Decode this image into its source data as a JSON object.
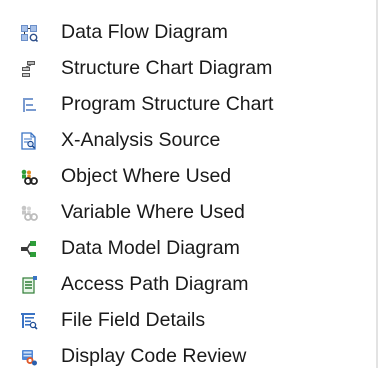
{
  "menu": {
    "items": [
      {
        "label": "Data Flow Diagram",
        "icon": "data-flow-diagram-icon"
      },
      {
        "label": "Structure Chart Diagram",
        "icon": "structure-chart-icon"
      },
      {
        "label": "Program Structure Chart",
        "icon": "program-structure-icon"
      },
      {
        "label": "X-Analysis Source",
        "icon": "source-document-icon"
      },
      {
        "label": "Object Where Used",
        "icon": "object-where-used-icon"
      },
      {
        "label": "Variable Where Used",
        "icon": "variable-where-used-icon"
      },
      {
        "label": "Data Model Diagram",
        "icon": "data-model-icon"
      },
      {
        "label": "Access Path Diagram",
        "icon": "access-path-icon"
      },
      {
        "label": "File Field Details",
        "icon": "file-field-details-icon"
      },
      {
        "label": "Display Code Review",
        "icon": "code-review-icon"
      }
    ]
  },
  "colors": {
    "background": "#ffffff",
    "text": "#1a1a1a",
    "border": "#e3e3e3",
    "icon_blue": "#3a73c4",
    "icon_green": "#2f9e3a",
    "icon_gray": "#8a8a8a",
    "icon_orange": "#e08a1e"
  }
}
